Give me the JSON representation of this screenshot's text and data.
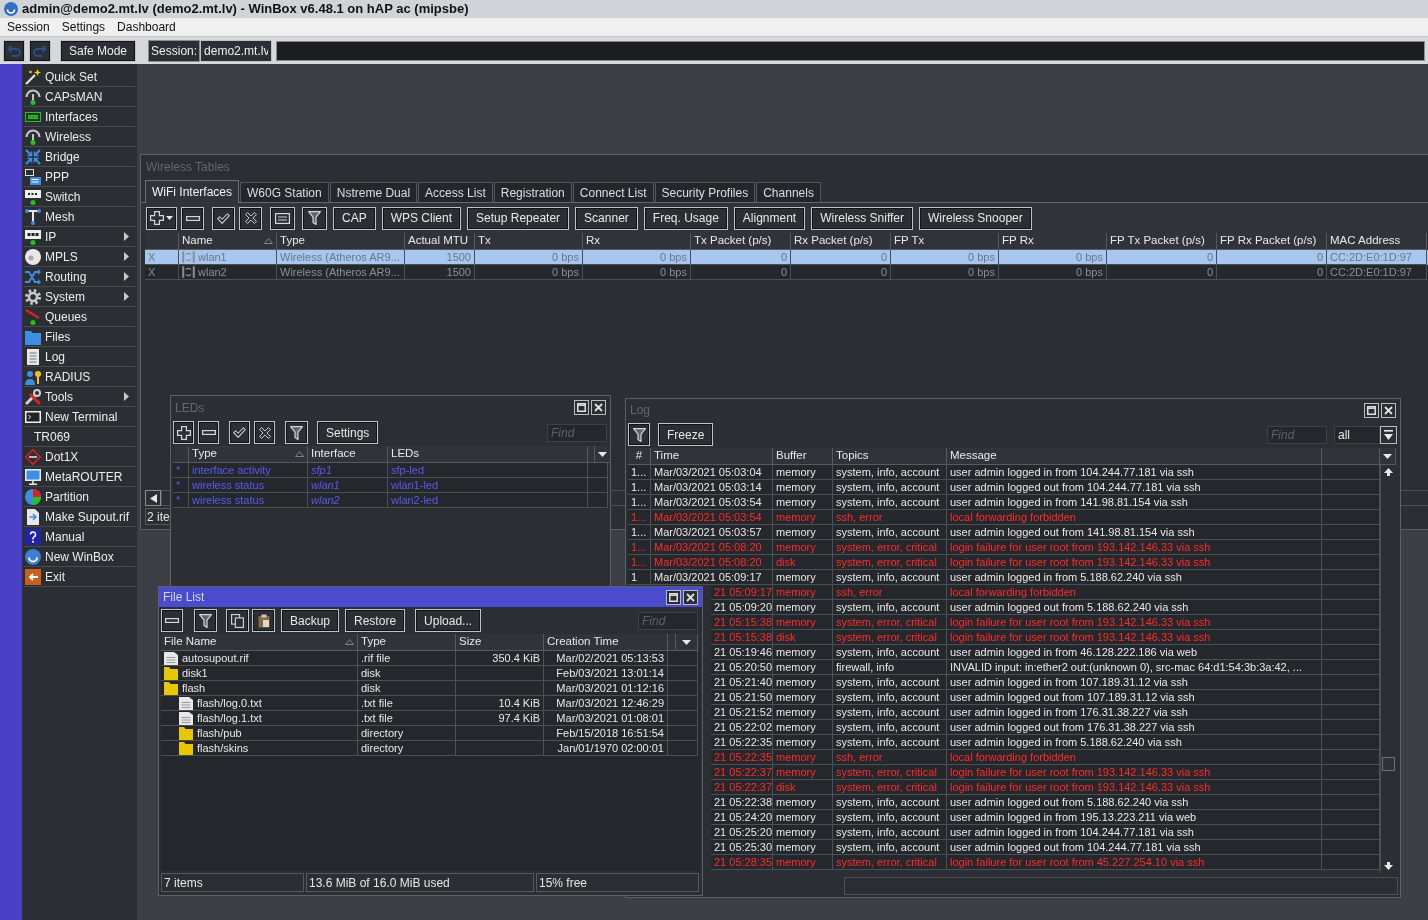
{
  "window": {
    "title": "admin@demo2.mt.lv (demo2.mt.lv) - WinBox v6.48.1 on hAP ac (mipsbe)"
  },
  "menu": [
    "Session",
    "Settings",
    "Dashboard"
  ],
  "toolbar": {
    "undo": {
      "disabled": true
    },
    "redo": {
      "disabled": true
    },
    "safe_mode": "Safe Mode",
    "session_label": "Session:",
    "session": "demo2.mt.lv"
  },
  "sidebar": {
    "items": [
      {
        "label": "Quick Set",
        "has_submenu": false
      },
      {
        "label": "CAPsMAN",
        "has_submenu": false
      },
      {
        "label": "Interfaces",
        "has_submenu": false
      },
      {
        "label": "Wireless",
        "has_submenu": false
      },
      {
        "label": "Bridge",
        "has_submenu": false
      },
      {
        "label": "PPP",
        "has_submenu": false
      },
      {
        "label": "Switch",
        "has_submenu": false
      },
      {
        "label": "Mesh",
        "has_submenu": false
      },
      {
        "label": "IP",
        "has_submenu": true
      },
      {
        "label": "MPLS",
        "has_submenu": true
      },
      {
        "label": "Routing",
        "has_submenu": true
      },
      {
        "label": "System",
        "has_submenu": true
      },
      {
        "label": "Queues",
        "has_submenu": false
      },
      {
        "label": "Files",
        "has_submenu": false
      },
      {
        "label": "Log",
        "has_submenu": false
      },
      {
        "label": "RADIUS",
        "has_submenu": false
      },
      {
        "label": "Tools",
        "has_submenu": true
      },
      {
        "label": "New Terminal",
        "has_submenu": false
      },
      {
        "label": "TR069",
        "has_submenu": false
      },
      {
        "label": "Dot1X",
        "has_submenu": false
      },
      {
        "label": "MetaROUTER",
        "has_submenu": false
      },
      {
        "label": "Partition",
        "has_submenu": false
      },
      {
        "label": "Make Supout.rif",
        "has_submenu": false
      },
      {
        "label": "Manual",
        "has_submenu": false
      },
      {
        "label": "New WinBox",
        "has_submenu": false
      },
      {
        "label": "Exit",
        "has_submenu": false
      }
    ]
  },
  "wireless_tables": {
    "title": "Wireless Tables",
    "tabs": [
      {
        "label": "WiFi Interfaces",
        "selected": true
      },
      {
        "label": "W60G Station",
        "selected": false
      },
      {
        "label": "Nstreme Dual",
        "selected": false
      },
      {
        "label": "Access List",
        "selected": false
      },
      {
        "label": "Registration",
        "selected": false
      },
      {
        "label": "Connect List",
        "selected": false
      },
      {
        "label": "Security Profiles",
        "selected": false
      },
      {
        "label": "Channels",
        "selected": false
      }
    ],
    "buttons": [
      "CAP",
      "WPS Client",
      "Setup Repeater",
      "Scanner",
      "Freq. Usage",
      "Alignment",
      "Wireless Sniffer",
      "Wireless Snooper"
    ],
    "table": {
      "columns": [
        {
          "label": "Name",
          "sorted": true
        },
        {
          "label": "Type",
          "sorted": false
        },
        {
          "label": "Actual MTU",
          "sorted": false
        },
        {
          "label": "Tx",
          "sorted": false
        },
        {
          "label": "Rx",
          "sorted": false
        },
        {
          "label": "Tx Packet (p/s)",
          "sorted": false
        },
        {
          "label": "Rx Packet (p/s)",
          "sorted": false
        },
        {
          "label": "FP Tx",
          "sorted": false
        },
        {
          "label": "FP Rx",
          "sorted": false
        },
        {
          "label": "FP Tx Packet (p/s)",
          "sorted": false
        },
        {
          "label": "FP Rx Packet (p/s)",
          "sorted": false
        },
        {
          "label": "MAC Address",
          "sorted": false
        }
      ],
      "rows": [
        {
          "flag": "X",
          "cells": [
            "wlan1",
            "Wireless (Atheros AR9...",
            "1500",
            "0 bps",
            "0 bps",
            "0",
            "0",
            "0 bps",
            "0 bps",
            "0",
            "0",
            "CC:2D:E0:1D:97"
          ],
          "selected": true,
          "disabled": true
        },
        {
          "flag": "X",
          "cells": [
            "wlan2",
            "Wireless (Atheros AR9...",
            "1500",
            "0 bps",
            "0 bps",
            "0",
            "0",
            "0 bps",
            "0 bps",
            "0",
            "0",
            "CC:2D:E0:1D:97"
          ],
          "selected": false,
          "disabled": true
        }
      ]
    },
    "status": "2 ite"
  },
  "leds": {
    "title": "LEDs",
    "settings_button": "Settings",
    "find_placeholder": "Find",
    "columns": [
      {
        "label": "Type",
        "sorted": true
      },
      {
        "label": "Interface",
        "sorted": false
      },
      {
        "label": "LEDs",
        "sorted": false
      }
    ],
    "rows": [
      {
        "flag": "*",
        "type": "interface activity",
        "interface": "sfp1",
        "leds": "sfp-led",
        "default": true
      },
      {
        "flag": "*",
        "type": "wireless status",
        "interface": "wlan1",
        "leds": "wlan1-led",
        "default": true
      },
      {
        "flag": "*",
        "type": "wireless status",
        "interface": "wlan2",
        "leds": "wlan2-led",
        "default": true
      }
    ]
  },
  "log": {
    "title": "Log",
    "freeze_button": "Freeze",
    "find_placeholder": "Find",
    "topic_filter": "all",
    "columns": [
      "#",
      "Time",
      "Buffer",
      "Topics",
      "Message"
    ],
    "rows": [
      {
        "number": "1...",
        "time": "Mar/03/2021 05:03:04",
        "buffer": "memory",
        "topics": "system, info, account",
        "message": "user admin logged in from 104.244.77.181 via ssh",
        "error": false
      },
      {
        "number": "1...",
        "time": "Mar/03/2021 05:03:14",
        "buffer": "memory",
        "topics": "system, info, account",
        "message": "user admin logged out from 104.244.77.181 via ssh",
        "error": false
      },
      {
        "number": "1...",
        "time": "Mar/03/2021 05:03:54",
        "buffer": "memory",
        "topics": "system, info, account",
        "message": "user admin logged in from 141.98.81.154 via ssh",
        "error": false
      },
      {
        "number": "1...",
        "time": "Mar/03/2021 05:03:54",
        "buffer": "memory",
        "topics": "ssh, error",
        "message": "local forwarding forbidden",
        "error": true
      },
      {
        "number": "1...",
        "time": "Mar/03/2021 05:03:57",
        "buffer": "memory",
        "topics": "system, info, account",
        "message": "user admin logged out from 141.98.81.154 via ssh",
        "error": false
      },
      {
        "number": "1...",
        "time": "Mar/03/2021 05:08:20",
        "buffer": "memory",
        "topics": "system, error, critical",
        "message": "login failure for user root from 193.142.146.33 via ssh",
        "error": true
      },
      {
        "number": "1...",
        "time": "Mar/03/2021 05:08:20",
        "buffer": "disk",
        "topics": "system, error, critical",
        "message": "login failure for user root from 193.142.146.33 via ssh",
        "error": true
      },
      {
        "number": "1",
        "time": "Mar/03/2021 05:09:17",
        "buffer": "memory",
        "topics": "system, info, account",
        "message": "user admin logged in from 5.188.62.240 via ssh",
        "error": false
      },
      {
        "time": "21 05:09:17",
        "buffer": "memory",
        "topics": "ssh, error",
        "message": "local forwarding forbidden",
        "error": true
      },
      {
        "time": "21 05:09:20",
        "buffer": "memory",
        "topics": "system, info, account",
        "message": "user admin logged out from 5.188.62.240 via ssh",
        "error": false
      },
      {
        "time": "21 05:15:38",
        "buffer": "memory",
        "topics": "system, error, critical",
        "message": "login failure for user root from 193.142.146.33 via ssh",
        "error": true
      },
      {
        "time": "21 05:15:38",
        "buffer": "disk",
        "topics": "system, error, critical",
        "message": "login failure for user root from 193.142.146.33 via ssh",
        "error": true
      },
      {
        "time": "21 05:19:46",
        "buffer": "memory",
        "topics": "system, info, account",
        "message": "user admin logged in from 46.128.222.186 via web",
        "error": false
      },
      {
        "time": "21 05:20:50",
        "buffer": "memory",
        "topics": "firewall, info",
        "message": "INVALID input: in:ether2 out:(unknown 0), src-mac 64:d1:54:3b:3a:42, ...",
        "error": false
      },
      {
        "time": "21 05:21:40",
        "buffer": "memory",
        "topics": "system, info, account",
        "message": "user admin logged in from 107.189.31.12 via ssh",
        "error": false
      },
      {
        "time": "21 05:21:50",
        "buffer": "memory",
        "topics": "system, info, account",
        "message": "user admin logged out from 107.189.31.12 via ssh",
        "error": false
      },
      {
        "time": "21 05:21:52",
        "buffer": "memory",
        "topics": "system, info, account",
        "message": "user admin logged in from 176.31.38.227 via ssh",
        "error": false
      },
      {
        "time": "21 05:22:02",
        "buffer": "memory",
        "topics": "system, info, account",
        "message": "user admin logged out from 176.31.38.227 via ssh",
        "error": false
      },
      {
        "time": "21 05:22:35",
        "buffer": "memory",
        "topics": "system, info, account",
        "message": "user admin logged in from 5.188.62.240 via ssh",
        "error": false
      },
      {
        "time": "21 05:22:35",
        "buffer": "memory",
        "topics": "ssh, error",
        "message": "local forwarding forbidden",
        "error": true
      },
      {
        "time": "21 05:22:37",
        "buffer": "memory",
        "topics": "system, error, critical",
        "message": "login failure for user root from 193.142.146.33 via ssh",
        "error": true
      },
      {
        "time": "21 05:22:37",
        "buffer": "disk",
        "topics": "system, error, critical",
        "message": "login failure for user root from 193.142.146.33 via ssh",
        "error": true
      },
      {
        "time": "21 05:22:38",
        "buffer": "memory",
        "topics": "system, info, account",
        "message": "user admin logged out from 5.188.62.240 via ssh",
        "error": false
      },
      {
        "time": "21 05:24:20",
        "buffer": "memory",
        "topics": "system, info, account",
        "message": "user admin logged in from 195.13.223.211 via web",
        "error": false
      },
      {
        "time": "21 05:25:20",
        "buffer": "memory",
        "topics": "system, info, account",
        "message": "user admin logged in from 104.244.77.181 via ssh",
        "error": false
      },
      {
        "time": "21 05:25:30",
        "buffer": "memory",
        "topics": "system, info, account",
        "message": "user admin logged out from 104.244.77.181 via ssh",
        "error": false
      },
      {
        "time": "21 05:28:35",
        "buffer": "memory",
        "topics": "system, error, critical",
        "message": "login failure for user root from 45.227.254.10 via ssh",
        "error": true
      }
    ]
  },
  "file_list": {
    "title": "File List",
    "buttons": [
      "Backup",
      "Restore",
      "Upload..."
    ],
    "find_placeholder": "Find",
    "columns": [
      {
        "label": "File Name",
        "sorted": true
      },
      {
        "label": "Type",
        "sorted": false
      },
      {
        "label": "Size",
        "sorted": false
      },
      {
        "label": "Creation Time",
        "sorted": false
      }
    ],
    "rows": [
      {
        "kind": "file",
        "name": "autosupout.rif",
        "type": ".rif file",
        "size": "350.4 KiB",
        "created": "Mar/02/2021 05:13:53"
      },
      {
        "kind": "folder",
        "name": "disk1",
        "type": "disk",
        "created": "Feb/03/2021 13:01:14"
      },
      {
        "kind": "folder",
        "name": "flash",
        "type": "disk",
        "created": "Mar/03/2021 01:12:16",
        "children": [
          {
            "kind": "file",
            "name": "flash/log.0.txt",
            "type": ".txt file",
            "size": "10.4 KiB",
            "created": "Mar/03/2021 12:46:29"
          },
          {
            "kind": "file",
            "name": "flash/log.1.txt",
            "type": ".txt file",
            "size": "97.4 KiB",
            "created": "Mar/03/2021 01:08:01"
          },
          {
            "kind": "folder",
            "name": "flash/pub",
            "type": "directory",
            "created": "Feb/15/2018 16:51:54"
          },
          {
            "kind": "folder",
            "name": "flash/skins",
            "type": "directory",
            "created": "Jan/01/1970 02:00:01"
          }
        ]
      }
    ],
    "status": [
      "7 items",
      "13.6 MiB of 16.0 MiB used",
      "15% free"
    ]
  }
}
